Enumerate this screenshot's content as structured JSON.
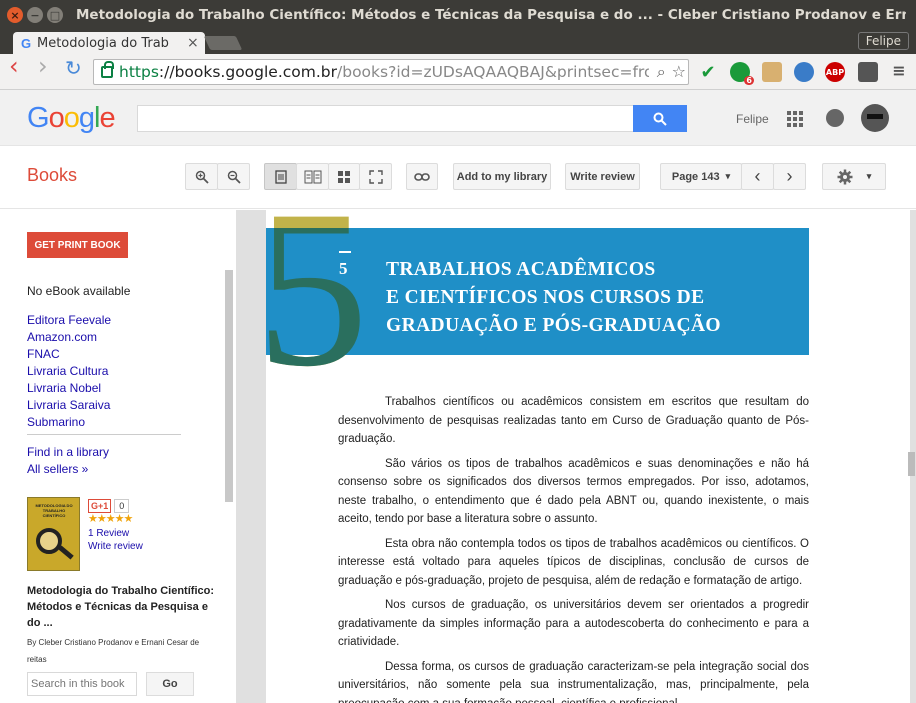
{
  "window": {
    "title": "Metodologia do Trabalho Científico: Métodos e Técnicas da Pesquisa e do ... - Cleber Cristiano Prodanov e Ernani Cesar",
    "close": "×",
    "min": "−",
    "max": "□"
  },
  "tab": {
    "favicon": "G",
    "label": "Metodologia do Trab",
    "close": "×"
  },
  "profile": "Felipe",
  "nav": {
    "back": "‹",
    "forward": "›",
    "reload": "↻"
  },
  "url": {
    "scheme": "https",
    "host": "://books.google.com.br",
    "path": "/books?id=zUDsAQAAQBAJ&printsec=frontc"
  },
  "extensions": {
    "check": "✔",
    "badge": "6",
    "abp": "ABP"
  },
  "google": {
    "logo": [
      "G",
      "o",
      "o",
      "g",
      "l",
      "e"
    ],
    "user": "Felipe"
  },
  "books": {
    "label": "Books",
    "toolbar": {
      "add_library": "Add to my library",
      "write_review": "Write review",
      "page": "Page 143",
      "page_caret": "▾",
      "prev": "‹",
      "next": "›",
      "settings_caret": "▾"
    }
  },
  "sidebar": {
    "get_print": "GET PRINT BOOK",
    "no_ebook": "No eBook available",
    "sellers": [
      "Editora Feevale",
      "Amazon.com",
      "FNAC",
      "Livraria Cultura",
      "Livraria Nobel",
      "Livraria Saraiva",
      "Submarino"
    ],
    "find_library": "Find in a library",
    "all_sellers": "All sellers »",
    "gplus": "G+1",
    "gplus_count": "0",
    "stars": "★★★★★",
    "reviews": "1 Review",
    "write_review": "Write review",
    "book_title": "Metodologia do Trabalho Científico: Métodos e Técnicas da Pesquisa e do ...",
    "book_author": "By Cleber Cristiano Prodanov e Ernani Cesar de reitas",
    "search_placeholder": "Search in this book",
    "go": "Go"
  },
  "page": {
    "big_number": "5",
    "chapter_number": "5",
    "chapter_title_lines": [
      "TRABALHOS ACADÊMICOS",
      "E CIENTÍFICOS NOS CURSOS DE",
      "GRADUAÇÃO E PÓS-GRADUAÇÃO"
    ],
    "paragraphs": [
      "Trabalhos científicos ou acadêmicos consistem em escritos que resultam do desenvolvimento de pesquisas realizadas tanto em Curso de Graduação quanto de Pós-graduação.",
      "São vários os tipos de trabalhos acadêmicos e suas denominações e não há consenso sobre os significados dos diversos termos empregados. Por isso, adotamos, neste trabalho, o entendimento que é dado pela ABNT ou, quando inexistente, o mais aceito, tendo por base a literatura sobre o assunto.",
      "Esta obra não contempla todos os tipos de trabalhos acadêmicos ou científicos. O interesse está voltado para aqueles típicos de disciplinas, conclusão de cursos de graduação e pós-graduação, projeto de pesquisa, além de redação e formatação de artigo.",
      "Nos cursos de graduação, os universitários devem ser orientados a progredir gradativamente da simples informação para a autodescoberta do conhecimento e para a criatividade.",
      "Dessa forma, os cursos de graduação caracterizam-se pela integração social dos universitários, não somente pela sua instrumentalização, mas, principalmente, pela preocupação com a sua formação pessoal, científica e profissional."
    ]
  }
}
